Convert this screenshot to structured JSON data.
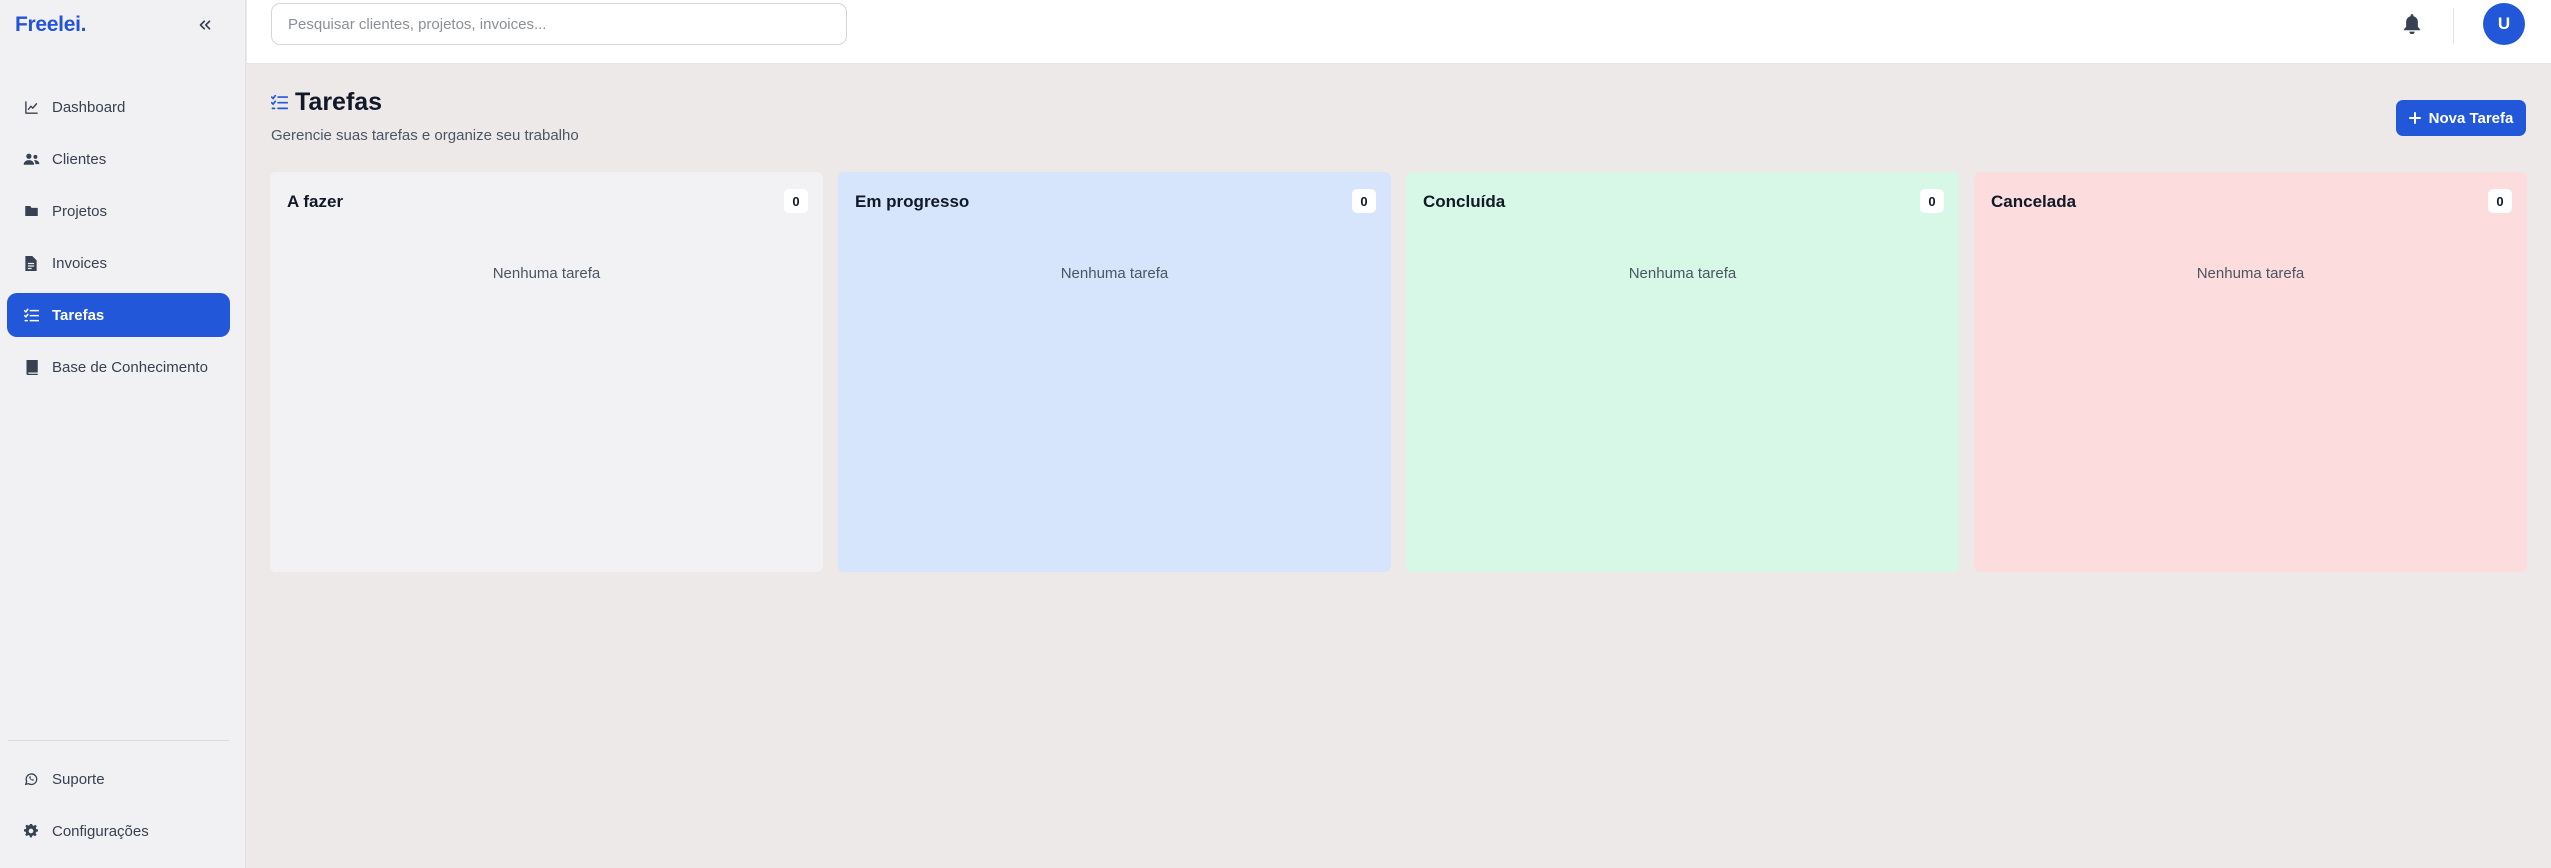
{
  "app": {
    "logo": "Freelei."
  },
  "sidebar": {
    "items": [
      {
        "label": "Dashboard",
        "icon": "chart-line-icon"
      },
      {
        "label": "Clientes",
        "icon": "users-icon"
      },
      {
        "label": "Projetos",
        "icon": "folder-icon"
      },
      {
        "label": "Invoices",
        "icon": "file-invoice-icon"
      },
      {
        "label": "Tarefas",
        "icon": "tasks-list-icon",
        "active": true
      },
      {
        "label": "Base de Conhecimento",
        "icon": "book-icon"
      }
    ],
    "footer": [
      {
        "label": "Suporte",
        "icon": "whatsapp-icon"
      },
      {
        "label": "Configurações",
        "icon": "gear-icon"
      }
    ]
  },
  "topbar": {
    "search_placeholder": "Pesquisar clientes, projetos, invoices...",
    "avatar_initial": "U"
  },
  "page": {
    "title": "Tarefas",
    "subtitle": "Gerencie suas tarefas e organize seu trabalho",
    "new_task_label": "Nova Tarefa"
  },
  "board": {
    "columns": [
      {
        "title": "A fazer",
        "count": "0",
        "empty": "Nenhuma tarefa",
        "color": "#f2f2f4"
      },
      {
        "title": "Em progresso",
        "count": "0",
        "empty": "Nenhuma tarefa",
        "color": "#d6e5fb"
      },
      {
        "title": "Concluída",
        "count": "0",
        "empty": "Nenhuma tarefa",
        "color": "#d7f8e6"
      },
      {
        "title": "Cancelada",
        "count": "0",
        "empty": "Nenhuma tarefa",
        "color": "#fcdcdd"
      }
    ]
  },
  "colors": {
    "accent": "#2257d9",
    "logo": "#2155d6"
  }
}
